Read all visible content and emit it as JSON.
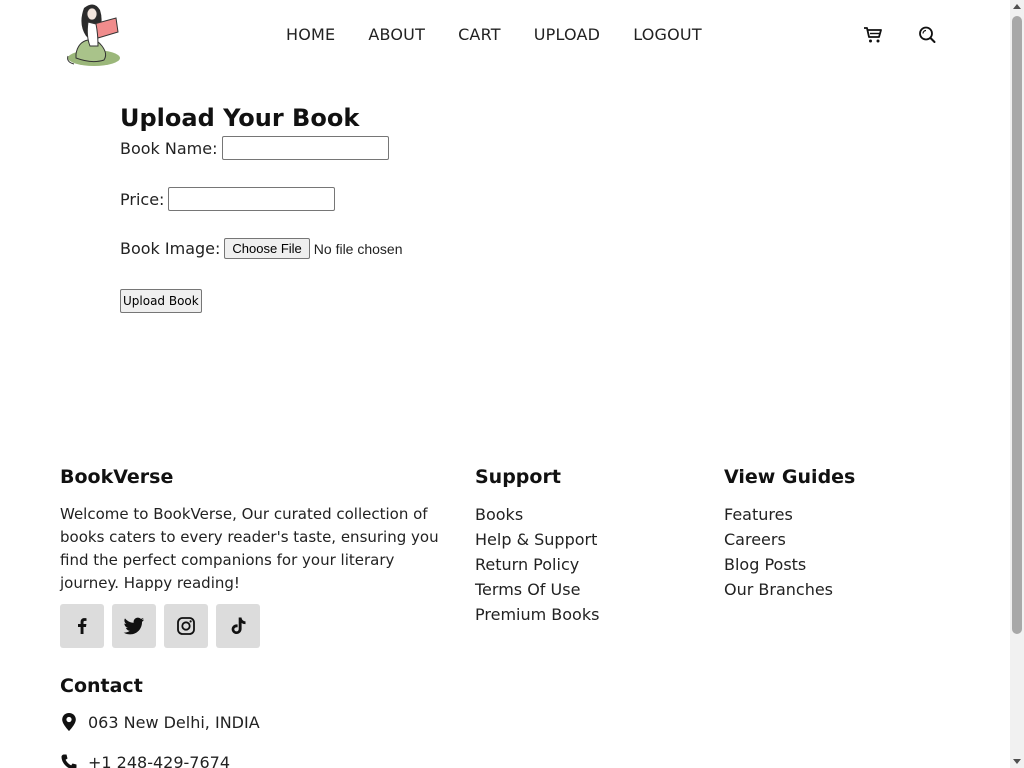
{
  "header": {
    "nav": [
      "HOME",
      "ABOUT",
      "CART",
      "UPLOAD",
      "LOGOUT"
    ],
    "icons": [
      "cart-icon",
      "search-icon"
    ]
  },
  "upload_form": {
    "title": "Upload Your Book",
    "book_name_label": "Book Name:",
    "book_name_value": "",
    "price_label": "Price:",
    "price_value": "",
    "book_image_label": "Book Image:",
    "choose_file_label": "Choose File",
    "file_status": "No file chosen",
    "submit_label": "Upload Book"
  },
  "footer": {
    "brand": "BookVerse",
    "about": "Welcome to BookVerse, Our curated collection of books caters to every reader's taste, ensuring you find the perfect companions for your literary journey. Happy reading!",
    "socials": [
      "facebook-icon",
      "twitter-icon",
      "instagram-icon",
      "tiktok-icon"
    ],
    "support_title": "Support",
    "support_links": [
      "Books",
      "Help & Support",
      "Return Policy",
      "Terms Of Use",
      "Premium Books"
    ],
    "guides_title": "View Guides",
    "guides_links": [
      "Features",
      "Careers",
      "Blog Posts",
      "Our Branches"
    ],
    "contact_title": "Contact",
    "address": "063 New Delhi, INDIA",
    "phone": "+1 248-429-7674"
  }
}
